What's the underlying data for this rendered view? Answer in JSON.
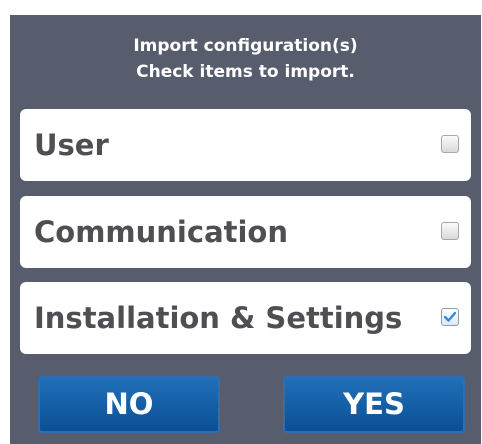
{
  "dialog": {
    "title_line1": "Import configuration(s)",
    "title_line2": "Check items to import."
  },
  "items": [
    {
      "label": "User",
      "checked": false
    },
    {
      "label": "Communication",
      "checked": false
    },
    {
      "label": "Installation & Settings",
      "checked": true
    }
  ],
  "buttons": {
    "no_label": "NO",
    "yes_label": "YES"
  },
  "colors": {
    "dialog_bg": "#575d6c",
    "item_bg": "#ffffff",
    "item_text": "#4f4f53",
    "button_bg": "#1560a8",
    "check_mark": "#2e8be6"
  }
}
